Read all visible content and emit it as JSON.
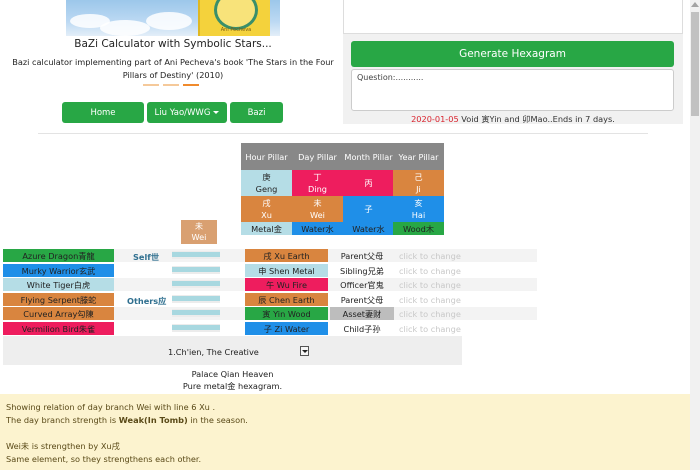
{
  "app": {
    "title": "BaZi Calculator with Symbolic Stars...",
    "description": "Bazi calculator implementing part of Ani Pecheva's book 'The Stars in the Four Pillars of Destiny' (2010)",
    "banner_author": "Ani Pecheva"
  },
  "nav": {
    "home": "Home",
    "liuyao": "Liu Yao/WWG",
    "bazi": "Bazi"
  },
  "panel": {
    "generate_label": "Generate Hexagram",
    "question_value": "Question:...........",
    "void_date": "2020-01-05",
    "void_text": " Void 寅Yin and 卯Mao..Ends in 7 days."
  },
  "pillars": {
    "headers": [
      "Hour Pillar",
      "Day Pillar",
      "Month Pillar",
      "Year Pillar"
    ],
    "stems": [
      {
        "text": "庚\nGeng",
        "bg": "#b5dde6",
        "fg": "#222222"
      },
      {
        "text": "丁\nDing",
        "bg": "#ee1d5e",
        "fg": "#ffffff"
      },
      {
        "text": "丙",
        "bg": "#ee1d5e",
        "fg": "#ffffff"
      },
      {
        "text": "己\nJi",
        "bg": "#d9853f",
        "fg": "#ffffff"
      }
    ],
    "branches": [
      {
        "text": "戌\nXu",
        "bg": "#d9853f",
        "fg": "#ffffff"
      },
      {
        "text": "未\nWei",
        "bg": "#d9853f",
        "fg": "#ffffff"
      },
      {
        "text": "子",
        "bg": "#1f8fe8",
        "fg": "#ffffff"
      },
      {
        "text": "亥\nHai",
        "bg": "#1f8fe8",
        "fg": "#ffffff"
      }
    ],
    "elements": [
      {
        "text": "Metal金",
        "bg": "#b5dde6",
        "fg": "#222222"
      },
      {
        "text": "Water水",
        "bg": "#1f8fe8",
        "fg": "#222222"
      },
      {
        "text": "Water水",
        "bg": "#1f8fe8",
        "fg": "#222222"
      },
      {
        "text": "Wood木",
        "bg": "#28a745",
        "fg": "#222222"
      }
    ],
    "day_branch_box": "未\nWei"
  },
  "lines": {
    "self_label": "Self世",
    "others_label": "Others应",
    "change_label": "click to change",
    "rows": [
      {
        "god": "Azure Dragon青龍",
        "god_bg": "#28a745",
        "branch": "戌 Xu Earth",
        "branch_bg": "#d9853f",
        "branch_fg": "#222222",
        "relation": "Parent父母"
      },
      {
        "god": "Murky Warrior玄武",
        "god_bg": "#1f8fe8",
        "branch": "申 Shen Metal",
        "branch_bg": "#b5dde6",
        "branch_fg": "#222222",
        "relation": "Sibling兄弟"
      },
      {
        "god": "White Tiger白虎",
        "god_bg": "#b5dde6",
        "branch": "午 Wu Fire",
        "branch_bg": "#ee1d5e",
        "branch_fg": "#222222",
        "relation": "Officer官鬼"
      },
      {
        "god": "Flying Serpent滕蛇",
        "god_bg": "#d9853f",
        "branch": "辰 Chen Earth",
        "branch_bg": "#d9853f",
        "branch_fg": "#222222",
        "relation": "Parent父母"
      },
      {
        "god": "Curved Array勾陳",
        "god_bg": "#d9853f",
        "branch": "寅 Yin Wood",
        "branch_bg": "#28a745",
        "branch_fg": "#222222",
        "relation": "Asset妻财",
        "relation_bg": "#bdbdbd"
      },
      {
        "god": "Vermilion Bird朱雀",
        "god_bg": "#ee1d5e",
        "branch": "子 Zi Water",
        "branch_bg": "#1f8fe8",
        "branch_fg": "#222222",
        "relation": "Child子孙"
      }
    ]
  },
  "hexagram": {
    "selected": "1.Ch'ien, The Creative",
    "palace": "Palace Qian Heaven",
    "description": "Pure metal金 hexagram."
  },
  "info": {
    "line1": "Showing relation of day branch Wei with line 6 Xu .",
    "line2_pre": "The day branch strength is ",
    "line2_bold": "Weak(In Tomb)",
    "line2_post": " in the season.",
    "line3": "Wei未 is strengthen by Xu戌",
    "line4": "Same element, so they strengthens each other."
  },
  "colors": {
    "green": "#28a745",
    "orange": "#d9853f",
    "pink": "#ee1d5e",
    "blue": "#1f8fe8",
    "light_blue": "#b5dde6",
    "void_date": "#d9232e"
  }
}
